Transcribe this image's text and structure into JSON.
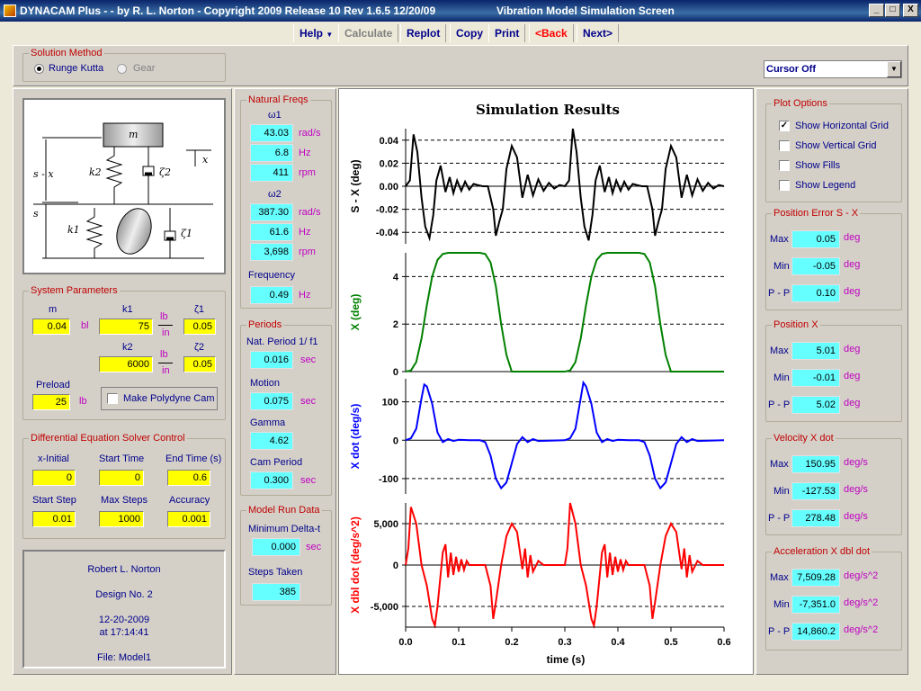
{
  "window": {
    "title": "DYNACAM Plus - - by R. L. Norton - Copyright 2009 Release 10 Rev 1.6.5 12/20/09",
    "screen_title": "Vibration Model Simulation Screen",
    "controls": [
      "_",
      "□",
      "X"
    ]
  },
  "toolbar": {
    "items": [
      "Help",
      "Calculate",
      "Replot",
      "Copy",
      "Print",
      "<Back",
      "Next>"
    ]
  },
  "solution_method": {
    "title": "Solution Method",
    "options": [
      "Runge Kutta",
      "Gear"
    ],
    "selected": "Runge Kutta"
  },
  "cursor_select": {
    "value": "Cursor Off"
  },
  "diagram": {
    "labels": [
      "m",
      "x",
      "s - x",
      "k2",
      "ζ2",
      "s",
      "k1",
      "ζ1"
    ]
  },
  "system_parameters": {
    "title": "System Parameters",
    "m": {
      "label": "m",
      "value": "0.04",
      "unit": "bl"
    },
    "k1": {
      "label": "k1",
      "value": "75",
      "unit_top": "lb",
      "unit_bottom": "in"
    },
    "zeta1": {
      "label": "ζ1",
      "value": "0.05"
    },
    "k2": {
      "label": "k2",
      "value": "6000",
      "unit_top": "lb",
      "unit_bottom": "in"
    },
    "zeta2": {
      "label": "ζ2",
      "value": "0.05"
    },
    "preload": {
      "label": "Preload",
      "value": "25",
      "unit": "lb"
    },
    "polydyne": {
      "label": "Make Polydyne Cam",
      "checked": false
    }
  },
  "solver": {
    "title": "Differential Equation Solver Control",
    "fields": [
      {
        "label": "x-Initial",
        "value": "0"
      },
      {
        "label": "Start Time",
        "value": "0"
      },
      {
        "label": "End Time (s)",
        "value": "0.6"
      },
      {
        "label": "Start Step",
        "value": "0.01"
      },
      {
        "label": "Max Steps",
        "value": "1000"
      },
      {
        "label": "Accuracy",
        "value": "0.001"
      }
    ]
  },
  "info": {
    "lines": [
      "Robert L. Norton",
      "Design No. 2",
      "12-20-2009",
      "at 17:14:41",
      "File: Model1"
    ]
  },
  "natural_freqs": {
    "title": "Natural Freqs",
    "w1_label": "ω1",
    "w1": [
      {
        "value": "43.03",
        "unit": "rad/s"
      },
      {
        "value": "6.8",
        "unit": "Hz"
      },
      {
        "value": "411",
        "unit": "rpm"
      }
    ],
    "w2_label": "ω2",
    "w2": [
      {
        "value": "387.30",
        "unit": "rad/s"
      },
      {
        "value": "61.6",
        "unit": "Hz"
      },
      {
        "value": "3,698",
        "unit": "rpm"
      }
    ],
    "frequency": {
      "label": "Frequency",
      "value": "0.49",
      "unit": "Hz"
    }
  },
  "periods": {
    "title": "Periods",
    "nat_period": {
      "label": "Nat. Period 1/ f1",
      "value": "0.016",
      "unit": "sec"
    },
    "motion": {
      "label": "Motion",
      "value": "0.075",
      "unit": "sec"
    },
    "gamma": {
      "label": "Gamma",
      "value": "4.62"
    },
    "cam_period": {
      "label": "Cam Period",
      "value": "0.300",
      "unit": "sec"
    }
  },
  "model_run": {
    "title": "Model Run Data",
    "min_delta": {
      "label": "Minimum Delta-t",
      "value": "0.000",
      "unit": "sec"
    },
    "steps": {
      "label": "Steps Taken",
      "value": "385"
    }
  },
  "plot_options": {
    "title": "Plot Options",
    "items": [
      {
        "label": "Show Horizontal Grid",
        "checked": true
      },
      {
        "label": "Show Vertical Grid",
        "checked": false
      },
      {
        "label": "Show Fills",
        "checked": false
      },
      {
        "label": "Show Legend",
        "checked": false
      }
    ]
  },
  "stats": [
    {
      "title": "Position Error  S - X",
      "rows": [
        {
          "label": "Max",
          "value": "0.05",
          "unit": "deg"
        },
        {
          "label": "Min",
          "value": "-0.05",
          "unit": "deg"
        },
        {
          "label": "P - P",
          "value": "0.10",
          "unit": "deg"
        }
      ]
    },
    {
      "title": "Position  X",
      "rows": [
        {
          "label": "Max",
          "value": "5.01",
          "unit": "deg"
        },
        {
          "label": "Min",
          "value": "-0.01",
          "unit": "deg"
        },
        {
          "label": "P - P",
          "value": "5.02",
          "unit": "deg"
        }
      ]
    },
    {
      "title": "Velocity  X dot",
      "rows": [
        {
          "label": "Max",
          "value": "150.95",
          "unit": "deg/s"
        },
        {
          "label": "Min",
          "value": "-127.53",
          "unit": "deg/s"
        },
        {
          "label": "P - P",
          "value": "278.48",
          "unit": "deg/s"
        }
      ]
    },
    {
      "title": "Acceleration  X dbl dot",
      "rows": [
        {
          "label": "Max",
          "value": "7,509.28",
          "unit": "deg/s^2"
        },
        {
          "label": "Min",
          "value": "-7,351.0",
          "unit": "deg/s^2"
        },
        {
          "label": "P - P",
          "value": "14,860.2",
          "unit": "deg/s^2"
        }
      ]
    }
  ],
  "chart_data": {
    "type": "line",
    "title": "Simulation Results",
    "xlabel": "time (s)",
    "x_ticks": [
      "0.0",
      "0.1",
      "0.2",
      "0.3",
      "0.4",
      "0.5",
      "0.6"
    ],
    "xlim": [
      0,
      0.6
    ],
    "grid": "horizontal",
    "panels": [
      {
        "name": "S - X (deg)",
        "ylabel": "S - X  (deg)",
        "color": "#000000",
        "ylim": [
          -0.05,
          0.05
        ],
        "ticks": [
          {
            "v": 0.04,
            "t": "0.04"
          },
          {
            "v": 0.02,
            "t": "0.02"
          },
          {
            "v": 0,
            "t": "0.00"
          },
          {
            "v": -0.02,
            "t": "-0.02"
          },
          {
            "v": -0.04,
            "t": "-0.04"
          }
        ],
        "x": [
          0,
          0.008,
          0.015,
          0.022,
          0.03,
          0.037,
          0.045,
          0.052,
          0.058,
          0.066,
          0.075,
          0.083,
          0.09,
          0.097,
          0.105,
          0.112,
          0.12,
          0.128,
          0.136,
          0.145,
          0.155,
          0.165,
          0.17,
          0.177,
          0.183,
          0.19,
          0.2,
          0.21,
          0.22,
          0.23,
          0.24,
          0.25,
          0.26,
          0.27,
          0.28,
          0.29,
          0.3,
          0.308,
          0.315,
          0.322,
          0.33,
          0.337,
          0.345,
          0.352,
          0.358,
          0.366,
          0.375,
          0.383,
          0.39,
          0.397,
          0.405,
          0.412,
          0.42,
          0.428,
          0.436,
          0.445,
          0.455,
          0.465,
          0.47,
          0.477,
          0.483,
          0.49,
          0.5,
          0.51,
          0.52,
          0.53,
          0.54,
          0.55,
          0.56,
          0.57,
          0.58,
          0.59,
          0.6
        ],
        "y": [
          0,
          0.005,
          0.045,
          0.03,
          -0.01,
          -0.035,
          -0.045,
          -0.025,
          0.005,
          0.018,
          -0.005,
          0.008,
          -0.006,
          0.005,
          -0.004,
          0.004,
          -0.003,
          0.002,
          0.001,
          0,
          0,
          -0.02,
          -0.043,
          -0.03,
          -0.02,
          0.015,
          0.035,
          0.025,
          -0.01,
          0.01,
          -0.008,
          0.006,
          -0.004,
          0.003,
          -0.002,
          0.001,
          0,
          0.005,
          0.05,
          0.03,
          -0.01,
          -0.035,
          -0.047,
          -0.025,
          0.005,
          0.018,
          -0.005,
          0.008,
          -0.006,
          0.005,
          -0.004,
          0.004,
          -0.003,
          0.002,
          0.001,
          0,
          0,
          -0.02,
          -0.043,
          -0.03,
          -0.02,
          0.015,
          0.035,
          0.025,
          -0.01,
          0.01,
          -0.008,
          0.006,
          -0.004,
          0.003,
          -0.002,
          0.001,
          0
        ]
      },
      {
        "name": "X (deg)",
        "ylabel": "X  (deg)",
        "color": "#008000",
        "ylim": [
          0,
          5
        ],
        "ticks": [
          {
            "v": 4,
            "t": "4"
          },
          {
            "v": 2,
            "t": "2"
          },
          {
            "v": 0,
            "t": "0"
          }
        ],
        "x": [
          0,
          0.01,
          0.02,
          0.03,
          0.04,
          0.05,
          0.06,
          0.07,
          0.08,
          0.09,
          0.1,
          0.14,
          0.15,
          0.16,
          0.17,
          0.18,
          0.19,
          0.2,
          0.3,
          0.31,
          0.32,
          0.33,
          0.34,
          0.35,
          0.36,
          0.37,
          0.38,
          0.39,
          0.4,
          0.44,
          0.45,
          0.46,
          0.47,
          0.48,
          0.49,
          0.5,
          0.6
        ],
        "y": [
          0,
          0.05,
          0.4,
          1.4,
          2.8,
          4.0,
          4.7,
          4.95,
          5.0,
          5.0,
          5.0,
          5.0,
          4.95,
          4.6,
          3.6,
          2.0,
          0.7,
          0,
          0,
          0.05,
          0.4,
          1.4,
          2.8,
          4.0,
          4.7,
          4.95,
          5.0,
          5.0,
          5.0,
          5.0,
          4.95,
          4.6,
          3.6,
          2.0,
          0.7,
          0,
          0
        ]
      },
      {
        "name": "X dot (deg/s)",
        "ylabel": "X dot  (deg/s)",
        "color": "#0000ff",
        "ylim": [
          -140,
          160
        ],
        "ticks": [
          {
            "v": 100,
            "t": "100"
          },
          {
            "v": 0,
            "t": "0"
          },
          {
            "v": -100,
            "t": "-100"
          }
        ],
        "x": [
          0,
          0.01,
          0.02,
          0.03,
          0.035,
          0.04,
          0.05,
          0.06,
          0.07,
          0.08,
          0.09,
          0.1,
          0.12,
          0.14,
          0.15,
          0.16,
          0.17,
          0.18,
          0.19,
          0.2,
          0.21,
          0.22,
          0.23,
          0.24,
          0.25,
          0.3,
          0.31,
          0.32,
          0.33,
          0.335,
          0.34,
          0.35,
          0.36,
          0.37,
          0.38,
          0.39,
          0.4,
          0.42,
          0.44,
          0.45,
          0.46,
          0.47,
          0.48,
          0.49,
          0.5,
          0.51,
          0.52,
          0.53,
          0.54,
          0.55,
          0.6
        ],
        "y": [
          0,
          5,
          30,
          110,
          145,
          140,
          95,
          20,
          -5,
          3,
          -2,
          1,
          0,
          0,
          -5,
          -40,
          -100,
          -125,
          -110,
          -60,
          -10,
          8,
          -5,
          3,
          -2,
          0,
          5,
          30,
          110,
          150,
          140,
          95,
          20,
          -5,
          3,
          -2,
          1,
          0,
          0,
          -5,
          -40,
          -100,
          -125,
          -110,
          -60,
          -10,
          8,
          -5,
          3,
          -2,
          0
        ]
      },
      {
        "name": "X dbl dot (deg/s^2)",
        "ylabel": "X dbl dot  (deg/s^2)",
        "color": "#ff0000",
        "ylim": [
          -7500,
          7500
        ],
        "ticks": [
          {
            "v": 5000,
            "t": "5,000"
          },
          {
            "v": 0,
            "t": "0"
          },
          {
            "v": -5000,
            "t": "-5,000"
          }
        ],
        "x": [
          0,
          0.005,
          0.01,
          0.02,
          0.03,
          0.04,
          0.05,
          0.055,
          0.06,
          0.07,
          0.075,
          0.08,
          0.085,
          0.09,
          0.095,
          0.1,
          0.105,
          0.11,
          0.115,
          0.12,
          0.13,
          0.14,
          0.15,
          0.16,
          0.165,
          0.17,
          0.18,
          0.19,
          0.2,
          0.21,
          0.22,
          0.225,
          0.23,
          0.235,
          0.24,
          0.25,
          0.26,
          0.3,
          0.305,
          0.31,
          0.32,
          0.33,
          0.34,
          0.35,
          0.355,
          0.36,
          0.37,
          0.375,
          0.38,
          0.385,
          0.39,
          0.395,
          0.4,
          0.405,
          0.41,
          0.415,
          0.42,
          0.43,
          0.44,
          0.45,
          0.46,
          0.465,
          0.47,
          0.48,
          0.49,
          0.5,
          0.51,
          0.52,
          0.525,
          0.53,
          0.535,
          0.54,
          0.55,
          0.56,
          0.6
        ],
        "y": [
          0,
          2000,
          7000,
          5000,
          0,
          -2500,
          -6500,
          -7300,
          -5000,
          1500,
          2500,
          -1500,
          1500,
          -1200,
          1000,
          -800,
          700,
          -600,
          500,
          0,
          0,
          0,
          0,
          -2500,
          -6500,
          -4500,
          0,
          3500,
          5000,
          4000,
          -500,
          2000,
          -1500,
          1200,
          -800,
          500,
          0,
          0,
          2000,
          7500,
          5000,
          0,
          -2500,
          -6500,
          -7300,
          -5000,
          1500,
          2500,
          -1500,
          1500,
          -1200,
          1000,
          -800,
          700,
          -600,
          500,
          0,
          0,
          0,
          0,
          -2500,
          -6500,
          -4500,
          0,
          3500,
          5000,
          4000,
          -500,
          2000,
          -1500,
          1200,
          -800,
          500,
          0,
          0
        ]
      }
    ]
  }
}
